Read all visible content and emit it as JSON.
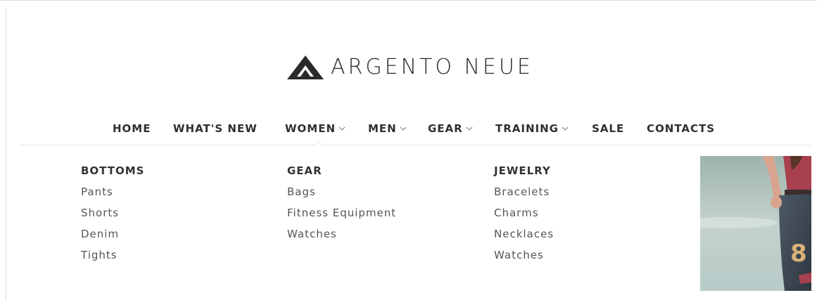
{
  "brand": {
    "name": "ARGENTO NEUE",
    "logo_icon": "triangle-mountain-icon"
  },
  "nav": {
    "items": [
      {
        "label": "HOME",
        "has_dropdown": false
      },
      {
        "label": "WHAT'S NEW",
        "has_dropdown": false
      },
      {
        "label": "WOMEN",
        "has_dropdown": true
      },
      {
        "label": "MEN",
        "has_dropdown": true
      },
      {
        "label": "GEAR",
        "has_dropdown": true
      },
      {
        "label": "TRAINING",
        "has_dropdown": true
      },
      {
        "label": "SALE",
        "has_dropdown": false
      },
      {
        "label": "CONTACTS",
        "has_dropdown": false
      }
    ],
    "active": "WOMEN"
  },
  "mega_menu": {
    "columns": [
      {
        "title": "BOTTOMS",
        "links": [
          "Pants",
          "Shorts",
          "Denim",
          "Tights"
        ]
      },
      {
        "title": "GEAR",
        "links": [
          "Bags",
          "Fitness Equipment",
          "Watches"
        ]
      },
      {
        "title": "JEWELRY",
        "links": [
          "Bracelets",
          "Charms",
          "Necklaces",
          "Watches"
        ]
      }
    ],
    "promo_image": "woman-in-denim-shorts-photo"
  },
  "colors": {
    "text_dark": "#2f2f2f",
    "text_link": "#555555",
    "divider": "#e6e6e6"
  }
}
